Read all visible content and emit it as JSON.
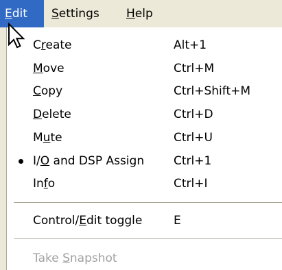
{
  "menubar": {
    "items": [
      {
        "mnemonic": "E",
        "rest": "dit"
      },
      {
        "mnemonic": "S",
        "rest": "ettings"
      },
      {
        "mnemonic": "H",
        "rest": "elp"
      }
    ]
  },
  "menu": {
    "items": [
      {
        "pre": "C",
        "mnemonic": "r",
        "post": "eate",
        "shortcut": "Alt+1"
      },
      {
        "pre": "",
        "mnemonic": "M",
        "post": "ove",
        "shortcut": "Ctrl+M"
      },
      {
        "pre": "",
        "mnemonic": "C",
        "post": "opy",
        "shortcut": "Ctrl+Shift+M"
      },
      {
        "pre": "",
        "mnemonic": "D",
        "post": "elete",
        "shortcut": "Ctrl+D"
      },
      {
        "pre": "M",
        "mnemonic": "u",
        "post": "te",
        "shortcut": "Ctrl+U"
      },
      {
        "pre": "I/",
        "mnemonic": "O",
        "post": " and DSP Assign",
        "shortcut": "Ctrl+1",
        "checked": true
      },
      {
        "pre": "In",
        "mnemonic": "f",
        "post": "o",
        "shortcut": "Ctrl+I"
      },
      {
        "pre": "Control/",
        "mnemonic": "E",
        "post": "dit toggle",
        "shortcut": "E"
      },
      {
        "pre": "Take ",
        "mnemonic": "S",
        "post": "napshot",
        "shortcut": "",
        "disabled": true
      }
    ]
  },
  "colors": {
    "menubar_bg": "#ece9d8",
    "highlight": "#316ac5",
    "disabled_text": "#a0a0a0",
    "separator": "#aca899"
  }
}
